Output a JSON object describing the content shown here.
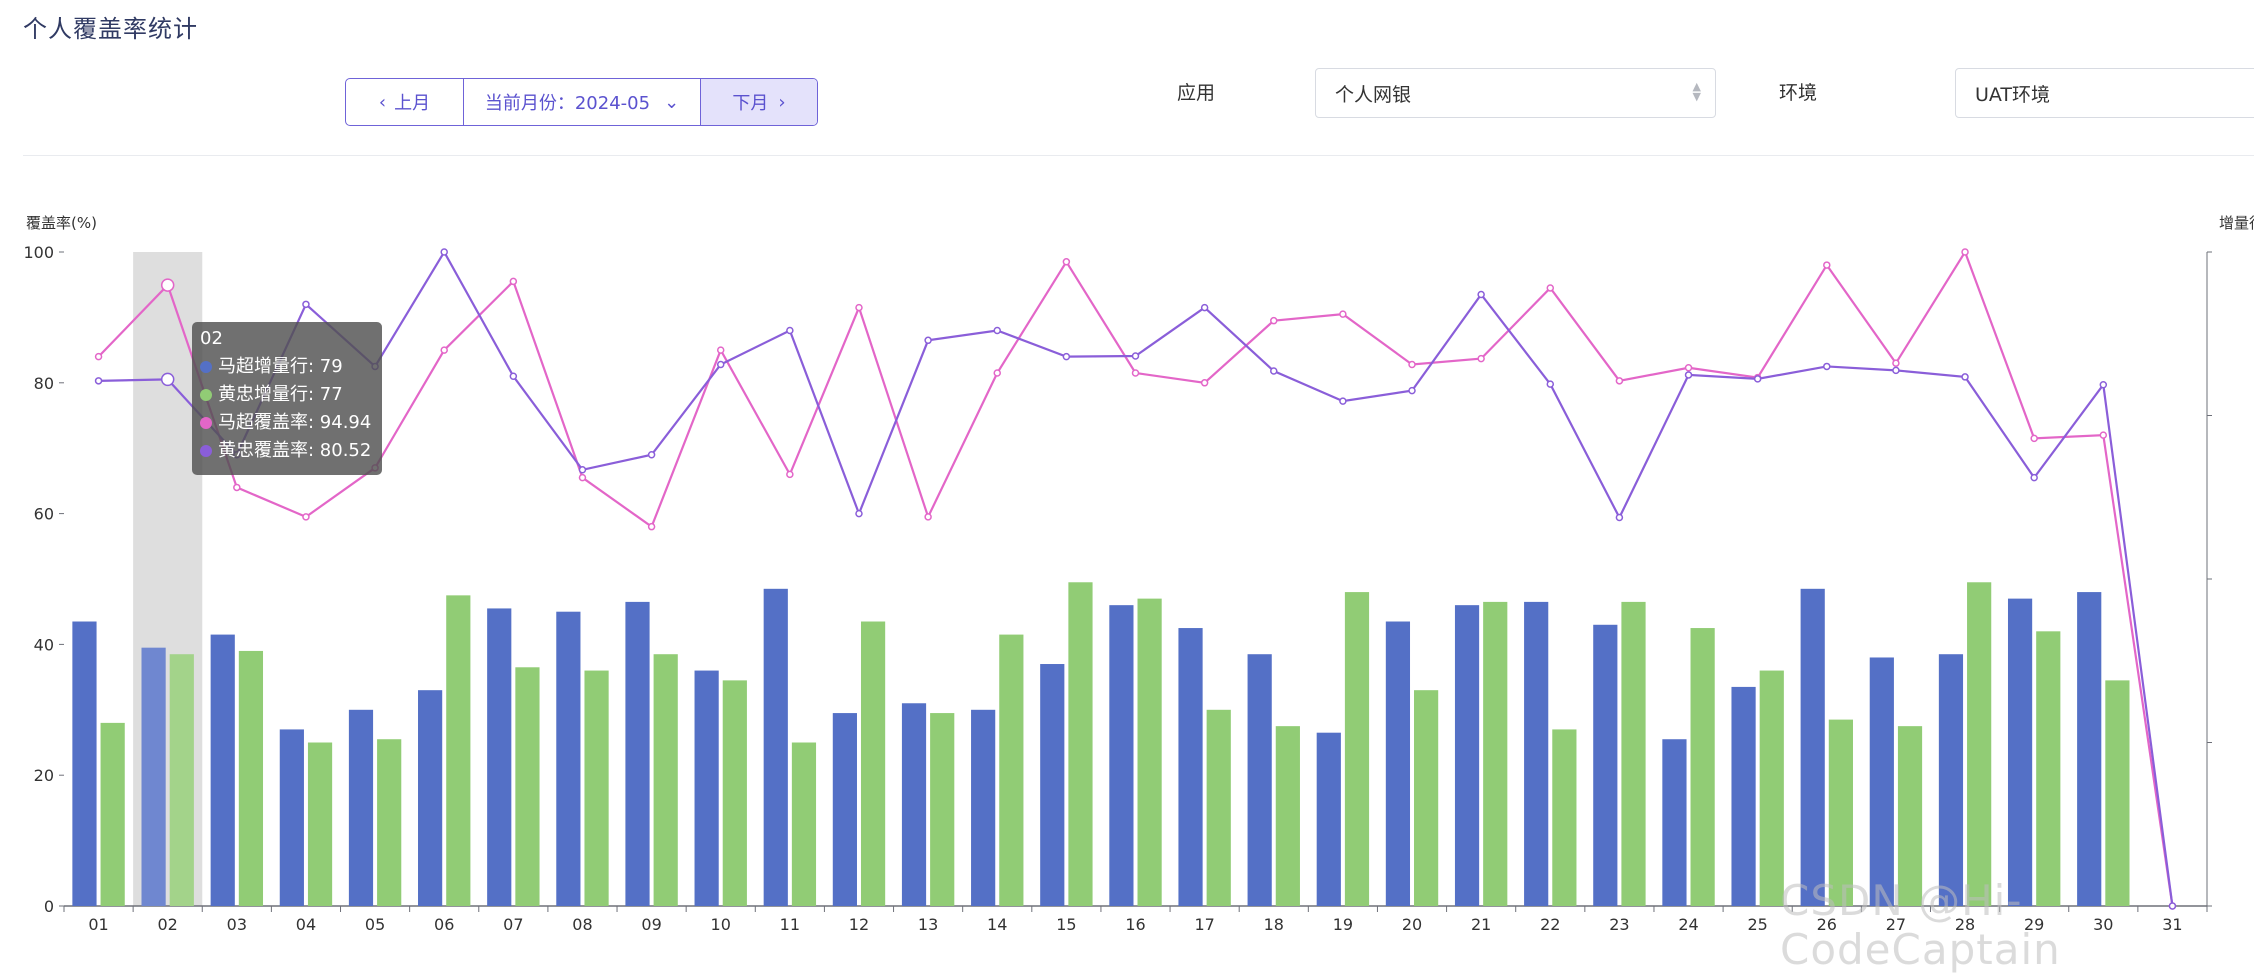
{
  "page": {
    "title": "个人覆盖率统计"
  },
  "month_switch": {
    "prev_label": "上月",
    "current_label": "当前月份：2024-05",
    "next_label": "下月"
  },
  "filters": {
    "app_label": "应用",
    "app_value": "个人网银",
    "env_label": "环境",
    "env_value": "UAT环境"
  },
  "tooltip": {
    "title": "02",
    "rows": [
      {
        "text": "马超增量行: 79",
        "color": "#5470c6"
      },
      {
        "text": "黄忠增量行: 77",
        "color": "#91cc75"
      },
      {
        "text": "马超覆盖率: 94.94",
        "color": "#e366c8"
      },
      {
        "text": "黄忠覆盖率: 80.52",
        "color": "#8a5ed9"
      }
    ]
  },
  "watermark": "CSDN @Hi-CodeCaptain",
  "chart_data": {
    "type": "bar",
    "categories": [
      "01",
      "02",
      "03",
      "04",
      "05",
      "06",
      "07",
      "08",
      "09",
      "10",
      "11",
      "12",
      "13",
      "14",
      "15",
      "16",
      "17",
      "18",
      "19",
      "20",
      "21",
      "22",
      "23",
      "24",
      "25",
      "26",
      "27",
      "28",
      "29",
      "30",
      "31"
    ],
    "ylabel": "覆盖率(%)",
    "y2label": "增量行",
    "ylim": [
      0,
      100
    ],
    "y2lim": [
      0,
      200
    ],
    "yticks": [
      0,
      20,
      40,
      60,
      80,
      100
    ],
    "highlighted_category": "02",
    "colors": {
      "bar1": "#5470c6",
      "bar2": "#91cc75",
      "line1": "#e366c8",
      "line2": "#8a5ed9"
    },
    "series": [
      {
        "name": "马超增量行",
        "type": "bar",
        "axis": "right",
        "values": [
          87,
          79,
          83,
          54,
          60,
          66,
          91,
          90,
          93,
          72,
          97,
          59,
          62,
          60,
          74,
          92,
          85,
          77,
          53,
          87,
          92,
          93,
          86,
          51,
          67,
          97,
          76,
          77,
          94,
          96,
          0
        ]
      },
      {
        "name": "黄忠增量行",
        "type": "bar",
        "axis": "right",
        "values": [
          56,
          77,
          78,
          50,
          51,
          95,
          73,
          72,
          77,
          69,
          50,
          87,
          59,
          83,
          99,
          94,
          60,
          55,
          96,
          66,
          93,
          54,
          93,
          85,
          72,
          57,
          55,
          99,
          84,
          69,
          0
        ]
      },
      {
        "name": "马超覆盖率",
        "type": "line",
        "axis": "left",
        "values": [
          84,
          94.94,
          64,
          59.5,
          67,
          85,
          95.5,
          65.5,
          58,
          85,
          66,
          91.5,
          59.5,
          81.5,
          98.5,
          81.5,
          80,
          89.5,
          90.5,
          82.8,
          83.7,
          94.5,
          80.3,
          82.3,
          80.8,
          98,
          83,
          100,
          71.5,
          72,
          0
        ]
      },
      {
        "name": "黄忠覆盖率",
        "type": "line",
        "axis": "left",
        "values": [
          80.3,
          80.52,
          69,
          92,
          82.5,
          100,
          81,
          66.7,
          69,
          82.8,
          88,
          60,
          86.5,
          88,
          84,
          84.1,
          91.5,
          81.8,
          77.2,
          78.8,
          93.5,
          79.8,
          59.4,
          81.2,
          80.6,
          82.5,
          81.9,
          80.9,
          65.5,
          79.7,
          0
        ]
      }
    ]
  }
}
